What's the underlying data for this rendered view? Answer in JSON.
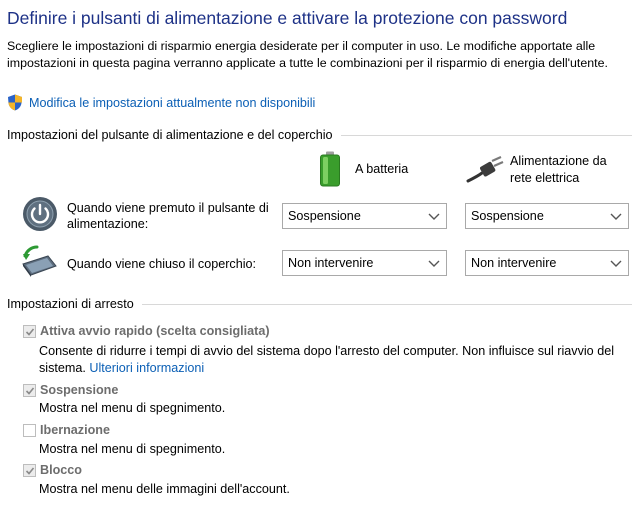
{
  "title": "Definire i pulsanti di alimentazione e attivare la protezione con password",
  "intro": "Scegliere le impostazioni di risparmio energia desiderate per il computer in uso. Le modifiche apportate alle impostazioni in questa pagina verranno applicate a tutte le combinazioni per il risparmio di energia dell'utente.",
  "admin_link": "Modifica le impostazioni attualmente non disponibili",
  "power_section": {
    "heading": "Impostazioni del pulsante di alimentazione e del coperchio",
    "col_battery": "A batteria",
    "col_plugged": "Alimentazione da rete elettrica",
    "rows": [
      {
        "label": "Quando viene premuto il pulsante di alimentazione:",
        "battery": "Sospensione",
        "plugged": "Sospensione"
      },
      {
        "label": "Quando viene chiuso il coperchio:",
        "battery": "Non intervenire",
        "plugged": "Non intervenire"
      }
    ]
  },
  "shutdown_section": {
    "heading": "Impostazioni di arresto",
    "fast_startup": {
      "label": "Attiva avvio rapido (scelta consigliata)",
      "checked": true,
      "desc": "Consente di ridurre i tempi di avvio del sistema dopo l'arresto del computer. Non influisce sul riavvio del sistema.",
      "more_link": "Ulteriori informazioni"
    },
    "sleep": {
      "label": "Sospensione",
      "checked": true,
      "desc": "Mostra nel menu di spegnimento."
    },
    "hibernate": {
      "label": "Ibernazione",
      "checked": false,
      "desc": "Mostra nel menu di spegnimento."
    },
    "lock": {
      "label": "Blocco",
      "checked": true,
      "desc": "Mostra nel menu delle immagini dell'account."
    }
  },
  "colors": {
    "title": "#1e3287",
    "link": "#0b5fb5",
    "disabled_text": "#6d6d6d"
  }
}
